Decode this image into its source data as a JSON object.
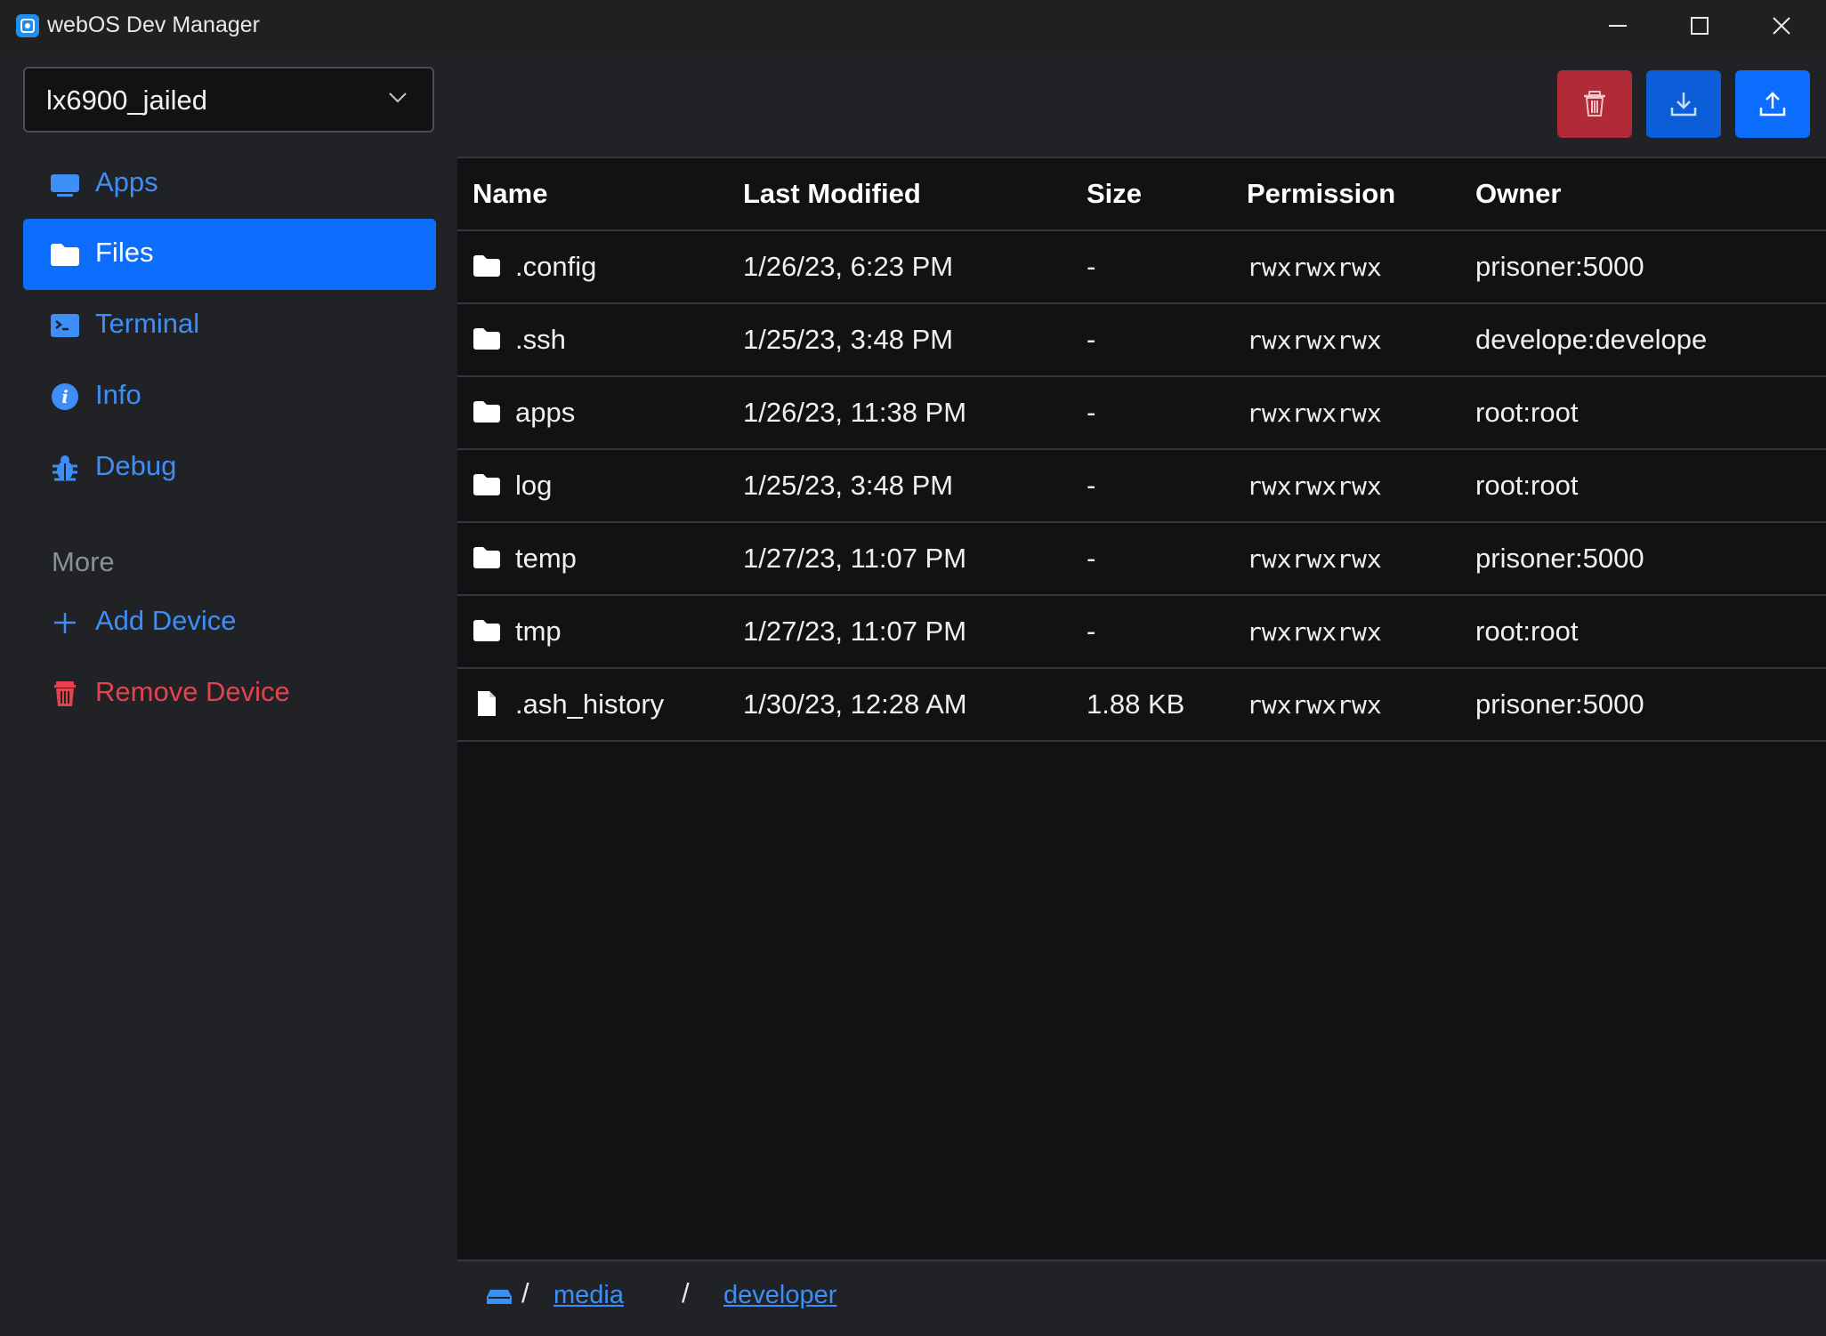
{
  "window": {
    "title": "webOS Dev Manager",
    "controls": [
      "minimize-icon",
      "maximize-icon",
      "close-icon"
    ]
  },
  "sidebar": {
    "device_select": {
      "value": "lx6900_jailed"
    },
    "nav": [
      {
        "label": "Apps",
        "icon": "monitor-icon",
        "active": false
      },
      {
        "label": "Files",
        "icon": "folder-icon",
        "active": true
      },
      {
        "label": "Terminal",
        "icon": "terminal-icon",
        "active": false
      },
      {
        "label": "Info",
        "icon": "info-icon",
        "active": false
      },
      {
        "label": "Debug",
        "icon": "bug-icon",
        "active": false
      }
    ],
    "more_label": "More",
    "more_items": [
      {
        "label": "Add Device",
        "icon": "plus-icon"
      },
      {
        "label": "Remove Device",
        "icon": "trash-icon"
      }
    ]
  },
  "toolbar": {
    "buttons": [
      {
        "icon": "trash-icon",
        "color": "#b02a37"
      },
      {
        "icon": "download-icon",
        "color": "#0b5ed7"
      },
      {
        "icon": "upload-icon",
        "color": "#0d6efd"
      }
    ]
  },
  "table": {
    "columns": [
      "Name",
      "Last Modified",
      "Size",
      "Permission",
      "Owner"
    ],
    "rows": [
      {
        "type": "folder",
        "name": ".config",
        "modified": "1/26/23, 6:23 PM",
        "size": "-",
        "permission": "rwxrwxrwx",
        "owner": "prisoner:5000"
      },
      {
        "type": "folder",
        "name": ".ssh",
        "modified": "1/25/23, 3:48 PM",
        "size": "-",
        "permission": "rwxrwxrwx",
        "owner": "develope:develope"
      },
      {
        "type": "folder",
        "name": "apps",
        "modified": "1/26/23, 11:38 PM",
        "size": "-",
        "permission": "rwxrwxrwx",
        "owner": "root:root"
      },
      {
        "type": "folder",
        "name": "log",
        "modified": "1/25/23, 3:48 PM",
        "size": "-",
        "permission": "rwxrwxrwx",
        "owner": "root:root"
      },
      {
        "type": "folder",
        "name": "temp",
        "modified": "1/27/23, 11:07 PM",
        "size": "-",
        "permission": "rwxrwxrwx",
        "owner": "prisoner:5000"
      },
      {
        "type": "folder",
        "name": "tmp",
        "modified": "1/27/23, 11:07 PM",
        "size": "-",
        "permission": "rwxrwxrwx",
        "owner": "root:root"
      },
      {
        "type": "file",
        "name": ".ash_history",
        "modified": "1/30/23, 12:28 AM",
        "size": "1.88 KB",
        "permission": "rwxrwxrwx",
        "owner": "prisoner:5000"
      }
    ]
  },
  "breadcrumb": {
    "root_icon": "drive-icon",
    "separator": "/",
    "parts": [
      "media",
      "developer"
    ]
  },
  "colors": {
    "accent": "#0d6efd",
    "link": "#3e8ef7",
    "danger": "#e2434f",
    "sidebar_bg": "#202225",
    "content_bg": "#111214"
  }
}
